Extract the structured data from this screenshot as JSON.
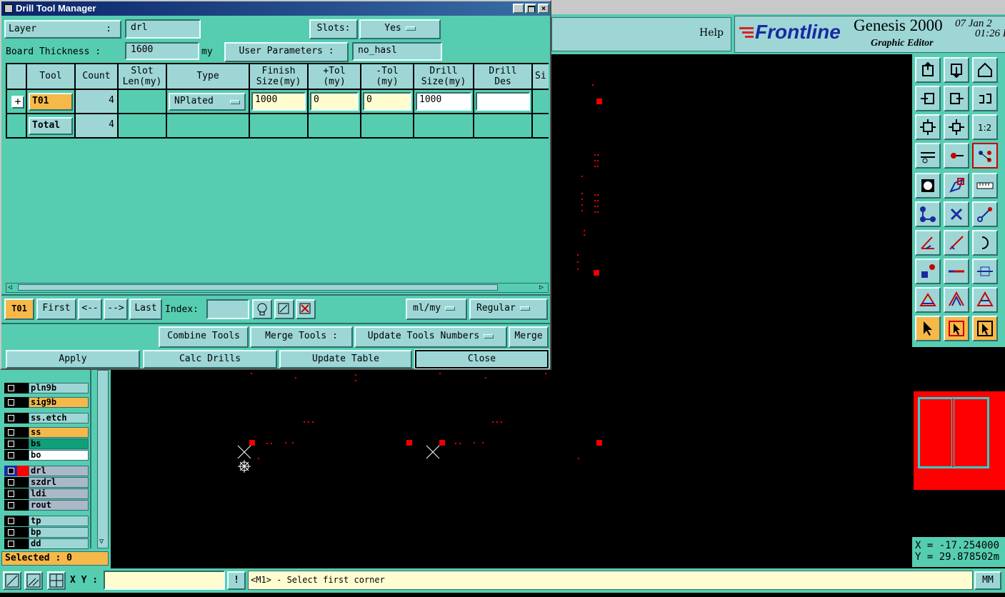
{
  "dialog": {
    "title": "Drill Tool Manager",
    "layer_label": "Layer",
    "layer_colon": ":",
    "layer_value": "drl",
    "slots_label": "Slots:",
    "slots_value": "Yes",
    "board_thickness_label": "Board Thickness :",
    "board_thickness_value": "1600",
    "board_thickness_unit": "my",
    "user_params_label": "User Parameters :",
    "user_params_value": "no_hasl",
    "columns": [
      "Tool",
      "Count",
      "Slot\nLen(my)",
      "Type",
      "Finish\nSize(my)",
      "+Tol\n(my)",
      "-Tol\n(my)",
      "Drill\nSize(my)",
      "Drill\nDes",
      "Si"
    ],
    "row1": {
      "tool": "T01",
      "count": "4",
      "type": "NPlated",
      "finish": "1000",
      "ptol": "0",
      "mtol": "0",
      "drill_size": "1000",
      "drill_des": ""
    },
    "total": {
      "label": "Total",
      "count": "4"
    },
    "nav": {
      "current": "T01",
      "first": "First",
      "prev": "<--",
      "next": "-->",
      "last": "Last",
      "index_label": "Index:",
      "index_value": "",
      "units": "ml/my",
      "mode": "Regular"
    },
    "combine_tools": "Combine Tools",
    "merge_tools_label": "Merge Tools :",
    "merge_option": "Update Tools Numbers",
    "merge": "Merge",
    "apply": "Apply",
    "calc_drills": "Calc Drills",
    "update_table": "Update Table",
    "close": "Close"
  },
  "app": {
    "help": "Help",
    "brand": "Frontline",
    "product": "Genesis 2000",
    "subtitle": "Graphic Editor",
    "date": "07 Jan 2",
    "time": "01:26 I",
    "coord_x": "X = -17.254000",
    "coord_y": "Y = 29.878502m",
    "unit_button": "MM"
  },
  "layers": [
    {
      "name": "pln9b",
      "bg": "#9ed6d6"
    },
    {
      "name": "sig9b",
      "bg": "#f7b84a"
    },
    {
      "name": "ss.etch",
      "bg": "#9ed6d6"
    },
    {
      "name": "ss",
      "bg": "#f7b84a"
    },
    {
      "name": "bs",
      "bg": "#0fa07a"
    },
    {
      "name": "bo",
      "bg": "#ffffff"
    },
    {
      "name": "drl",
      "bg": "#aab8c8"
    },
    {
      "name": "szdrl",
      "bg": "#aab8c8"
    },
    {
      "name": "ldi",
      "bg": "#aab8c8"
    },
    {
      "name": "rout",
      "bg": "#aab8c8"
    },
    {
      "name": "tp",
      "bg": "#9ed6d6"
    },
    {
      "name": "bp",
      "bg": "#9ed6d6"
    },
    {
      "name": "dd",
      "bg": "#9ed6d6"
    }
  ],
  "selected_text": "Selected : 0",
  "status": {
    "xy_label": "X Y :",
    "xy_value": "",
    "message": "<M1> - Select first corner"
  }
}
